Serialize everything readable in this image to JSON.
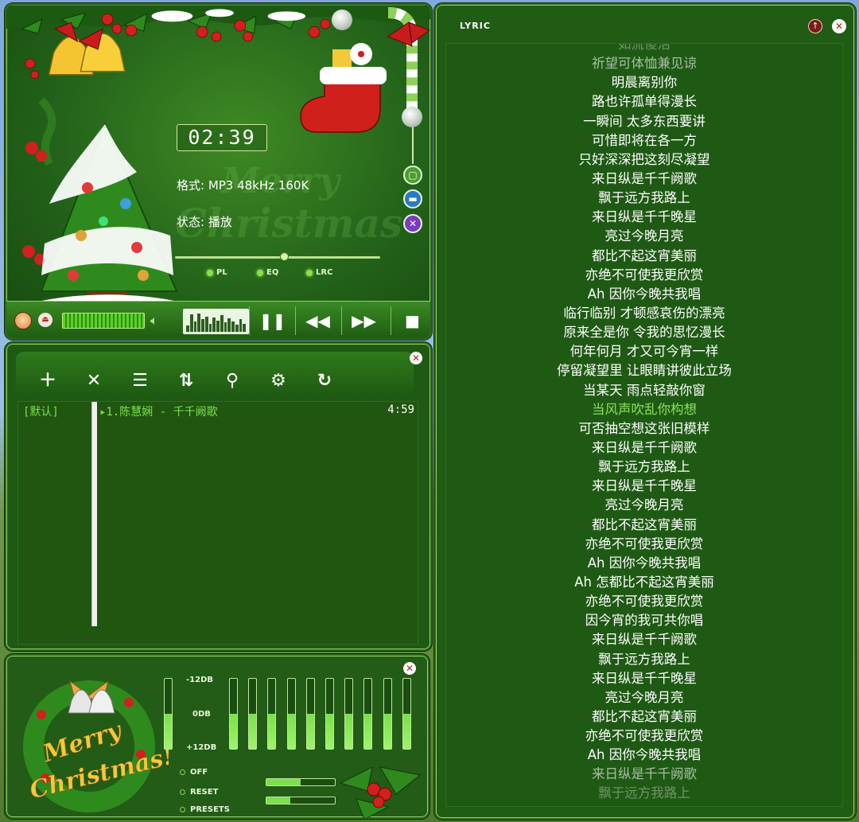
{
  "player": {
    "time": "02:39",
    "format": "格式: MP3 48kHz 160K",
    "state": "状态: 播放",
    "bg_text_1": "Merry",
    "bg_text_2": "Christmas",
    "seek_progress": 0.53,
    "toggles": {
      "pl": "PL",
      "eq": "EQ",
      "lrc": "LRC"
    },
    "spectrum": [
      0.3,
      0.85,
      0.5,
      0.9,
      0.6,
      0.75,
      0.4,
      0.7,
      0.55,
      0.8,
      0.45,
      0.65,
      0.5,
      0.35,
      0.6,
      0.4
    ]
  },
  "playlist": {
    "group": "[默认]",
    "tracks": [
      {
        "title": "▸1.陈慧娴 - 千千阙歌",
        "duration": "4:59"
      }
    ],
    "toolbar": [
      "add-icon",
      "remove-icon",
      "list-icon",
      "sort-icon",
      "search-icon",
      "settings-icon",
      "repeat-icon"
    ]
  },
  "equalizer": {
    "scale_top": "-12DB",
    "scale_mid": "0DB",
    "scale_bottom": "+12DB",
    "options": {
      "off": "OFF",
      "reset": "RESET",
      "presets": "PRESETS"
    },
    "art_text_1": "Merry",
    "art_text_2": "Christmas!",
    "bands": 11,
    "mini_1": 0.5,
    "mini_2": 0.35
  },
  "lyric": {
    "title": "LYRIC",
    "current_index": 19,
    "lines": [
      "如流傻活",
      "祈望可体恤兼见谅",
      "明晨离别你",
      "路也许孤单得漫长",
      "一瞬间 太多东西要讲",
      "可惜即将在各一方",
      "只好深深把这刻尽凝望",
      "来日纵是千千阙歌",
      "飘于远方我路上",
      "来日纵是千千晚星",
      "亮过今晚月亮",
      "都比不起这宵美丽",
      "亦绝不可使我更欣赏",
      "Ah 因你今晚共我唱",
      "临行临别 才顿感哀伤的漂亮",
      "原来全是你 令我的思忆漫长",
      "何年何月 才又可今宵一样",
      "停留凝望里 让眼睛讲彼此立场",
      "当某天 雨点轻敲你窗",
      "当风声吹乱你构想",
      "可否抽空想这张旧模样",
      "来日纵是千千阙歌",
      "飘于远方我路上",
      "来日纵是千千晚星",
      "亮过今晚月亮",
      "都比不起这宵美丽",
      "亦绝不可使我更欣赏",
      "Ah 因你今晚共我唱",
      "Ah 怎都比不起这宵美丽",
      "亦绝不可使我更欣赏",
      "因今宵的我可共你唱",
      "来日纵是千千阙歌",
      "飘于远方我路上",
      "来日纵是千千晚星",
      "亮过今晚月亮",
      "都比不起这宵美丽",
      "亦绝不可使我更欣赏",
      "Ah 因你今晚共我唱",
      "来日纵是千千阙歌",
      "飘于远方我路上"
    ]
  }
}
